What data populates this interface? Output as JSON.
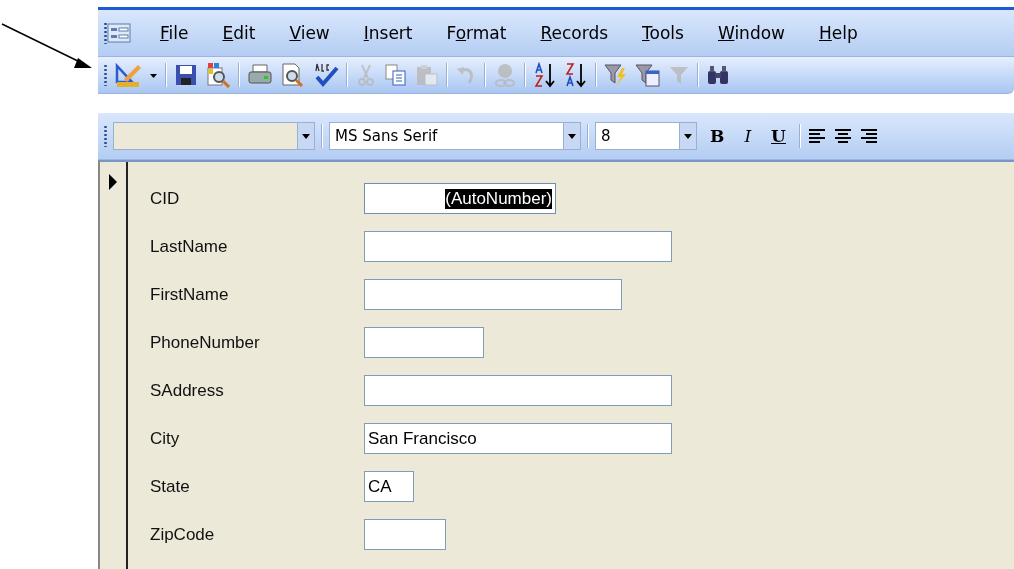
{
  "menu": [
    {
      "key": "F",
      "post": "ile"
    },
    {
      "key": "E",
      "post": "dit"
    },
    {
      "key": "V",
      "post": "iew"
    },
    {
      "key": "I",
      "post": "nsert"
    },
    {
      "pre": "F",
      "key": "o",
      "post": "rmat"
    },
    {
      "key": "R",
      "post": "ecords"
    },
    {
      "key": "T",
      "post": "ools"
    },
    {
      "key": "W",
      "post": "indow"
    },
    {
      "key": "H",
      "post": "elp"
    }
  ],
  "toolbar": [
    {
      "kind": "design",
      "disabled": false
    },
    {
      "kind": "caret",
      "disabled": false
    },
    {
      "kind": "sep"
    },
    {
      "kind": "save",
      "disabled": false
    },
    {
      "kind": "search-doc",
      "disabled": false
    },
    {
      "kind": "sep"
    },
    {
      "kind": "print",
      "disabled": false
    },
    {
      "kind": "preview",
      "disabled": false
    },
    {
      "kind": "spell",
      "disabled": false
    },
    {
      "kind": "sep"
    },
    {
      "kind": "cut",
      "disabled": true
    },
    {
      "kind": "copy",
      "disabled": false
    },
    {
      "kind": "paste",
      "disabled": true
    },
    {
      "kind": "sep"
    },
    {
      "kind": "undo",
      "disabled": true
    },
    {
      "kind": "sep"
    },
    {
      "kind": "link",
      "disabled": true
    },
    {
      "kind": "sep"
    },
    {
      "kind": "sort-asc",
      "disabled": false
    },
    {
      "kind": "sort-desc",
      "disabled": false
    },
    {
      "kind": "sep"
    },
    {
      "kind": "filter-selection",
      "disabled": false
    },
    {
      "kind": "filter-form",
      "disabled": false
    },
    {
      "kind": "filter",
      "disabled": true
    },
    {
      "kind": "sep"
    },
    {
      "kind": "find",
      "disabled": false
    }
  ],
  "format_bar": {
    "font": {
      "value": "MS Sans Serif"
    },
    "size": {
      "value": "8"
    },
    "buttons": [
      {
        "kind": "bold",
        "label": "B"
      },
      {
        "kind": "italic",
        "label": "I"
      },
      {
        "kind": "underline",
        "label": "U"
      },
      {
        "kind": "sep"
      },
      {
        "kind": "align-left"
      },
      {
        "kind": "align-center"
      },
      {
        "kind": "align-right"
      }
    ]
  },
  "form": {
    "fields": [
      {
        "label": "CID",
        "value": "(AutoNumber)",
        "highlighted": true
      },
      {
        "label": "LastName",
        "highlighted": false
      },
      {
        "label": "FirstName",
        "highlighted": false
      },
      {
        "label": "PhoneNumber",
        "highlighted": false
      },
      {
        "label": "SAddress",
        "highlighted": false
      },
      {
        "label": "City",
        "value": "San Francisco",
        "highlighted": false
      },
      {
        "label": "State",
        "value": "CA",
        "highlighted": false
      },
      {
        "label": "ZipCode",
        "highlighted": false
      }
    ]
  }
}
